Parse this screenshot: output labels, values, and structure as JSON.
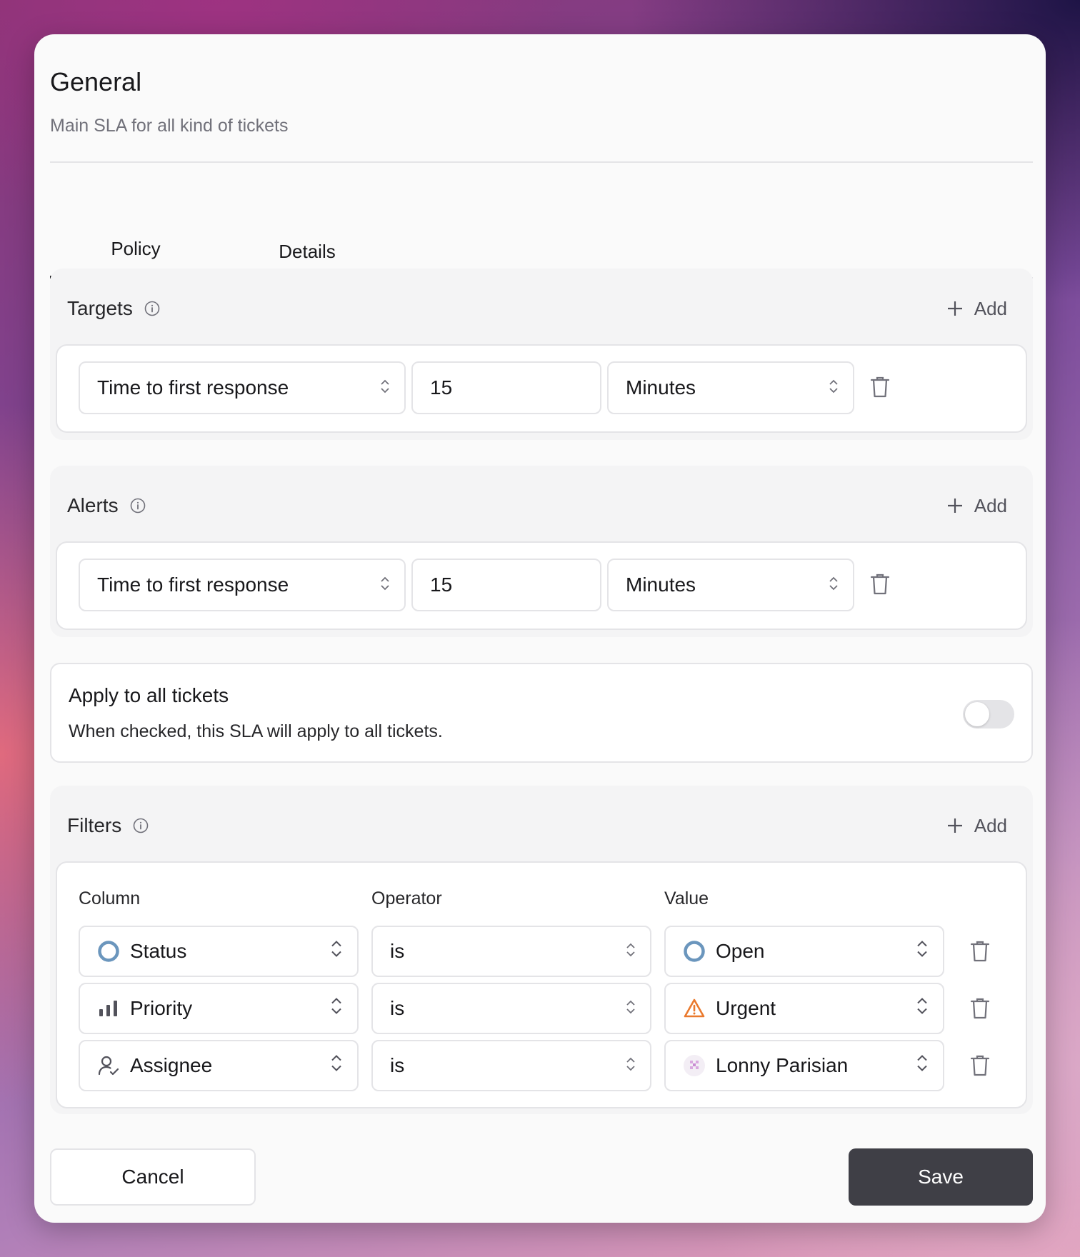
{
  "dialog": {
    "title": "General",
    "subtitle": "Main SLA for all kind of tickets"
  },
  "tabs": [
    {
      "label": "Policy",
      "active": true
    },
    {
      "label": "Details",
      "active": false
    }
  ],
  "targets": {
    "title": "Targets",
    "add_label": "Add",
    "row": {
      "metric": "Time to first response",
      "amount": "15",
      "unit": "Minutes"
    }
  },
  "alerts": {
    "title": "Alerts",
    "add_label": "Add",
    "row": {
      "metric": "Time to first response",
      "amount": "15",
      "unit": "Minutes"
    }
  },
  "apply_all": {
    "title": "Apply to all tickets",
    "description": "When checked, this SLA will apply to all tickets.",
    "enabled": false
  },
  "filters": {
    "title": "Filters",
    "add_label": "Add",
    "headers": {
      "column": "Column",
      "operator": "Operator",
      "value": "Value"
    },
    "rows": [
      {
        "column": "Status",
        "column_icon": "status-circle-icon",
        "operator": "is",
        "value": "Open",
        "value_icon": "status-circle-icon"
      },
      {
        "column": "Priority",
        "column_icon": "bar-chart-icon",
        "operator": "is",
        "value": "Urgent",
        "value_icon": "warning-triangle-icon"
      },
      {
        "column": "Assignee",
        "column_icon": "user-check-icon",
        "operator": "is",
        "value": "Lonny Parisian",
        "value_icon": "avatar-icon"
      }
    ]
  },
  "footer": {
    "cancel_label": "Cancel",
    "save_label": "Save"
  },
  "colors": {
    "status_open": "#6b96bd",
    "urgent": "#ea7a2e",
    "save_bg": "#3f3f46"
  }
}
